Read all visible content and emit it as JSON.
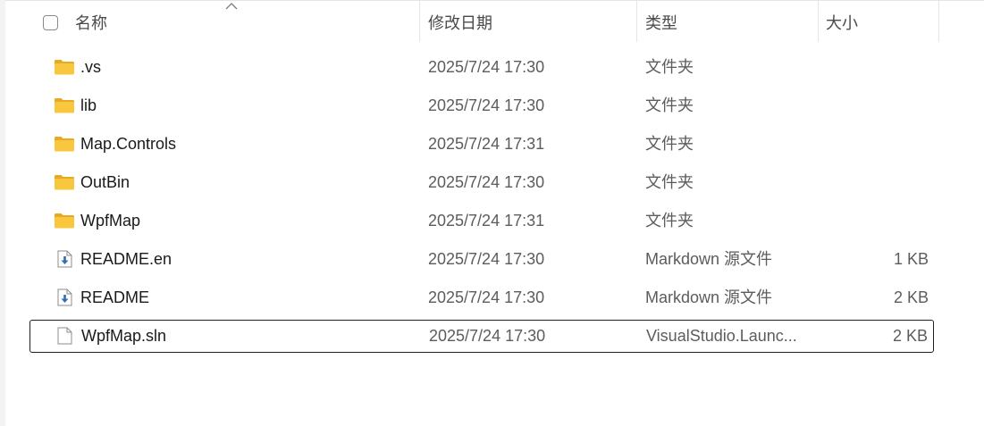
{
  "header": {
    "name_label": "名称",
    "date_label": "修改日期",
    "type_label": "类型",
    "size_label": "大小",
    "sort_icon": "chevron-up-icon"
  },
  "files": [
    {
      "name": ".vs",
      "date": "2025/7/24 17:30",
      "type": "文件夹",
      "size": "",
      "icon": "folder-icon"
    },
    {
      "name": "lib",
      "date": "2025/7/24 17:30",
      "type": "文件夹",
      "size": "",
      "icon": "folder-icon"
    },
    {
      "name": "Map.Controls",
      "date": "2025/7/24 17:31",
      "type": "文件夹",
      "size": "",
      "icon": "folder-icon"
    },
    {
      "name": "OutBin",
      "date": "2025/7/24 17:30",
      "type": "文件夹",
      "size": "",
      "icon": "folder-icon"
    },
    {
      "name": "WpfMap",
      "date": "2025/7/24 17:31",
      "type": "文件夹",
      "size": "",
      "icon": "folder-icon"
    },
    {
      "name": "README.en",
      "date": "2025/7/24 17:30",
      "type": "Markdown 源文件",
      "size": "1 KB",
      "icon": "markdown-file-icon"
    },
    {
      "name": "README",
      "date": "2025/7/24 17:30",
      "type": "Markdown 源文件",
      "size": "2 KB",
      "icon": "markdown-file-icon"
    },
    {
      "name": "WpfMap.sln",
      "date": "2025/7/24 17:30",
      "type": "VisualStudio.Launc...",
      "size": "2 KB",
      "icon": "file-icon",
      "selected": true
    }
  ],
  "colors": {
    "folder": "#f8c73e",
    "folder_dark": "#e8a824",
    "markdown_arrow": "#2f6fb0",
    "selection_border": "#1f1f1f"
  }
}
